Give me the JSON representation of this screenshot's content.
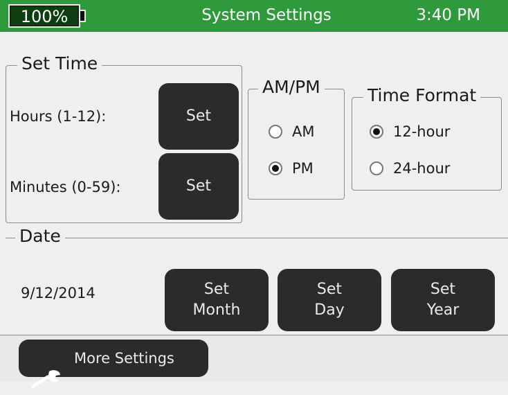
{
  "header": {
    "battery": "100%",
    "battery_level": 1.0,
    "title": "System Settings",
    "time": "3:40 PM",
    "color": "#2f9a3c"
  },
  "set_time": {
    "legend": "Set Time",
    "hours_label": "Hours (1-12):",
    "hours_button": "Set",
    "minutes_label": "Minutes (0-59):",
    "minutes_button": "Set"
  },
  "ampm": {
    "legend": "AM/PM",
    "options": [
      "AM",
      "PM"
    ],
    "selected": "PM"
  },
  "time_format": {
    "legend": "Time Format",
    "options": [
      "12-hour",
      "24-hour"
    ],
    "selected": "12-hour"
  },
  "date": {
    "legend": "Date",
    "value": "9/12/2014",
    "buttons": [
      "Set\nMonth",
      "Set\nDay",
      "Set\nYear"
    ]
  },
  "footer": {
    "more_settings": "More Settings",
    "icon": "wrench-icon"
  }
}
